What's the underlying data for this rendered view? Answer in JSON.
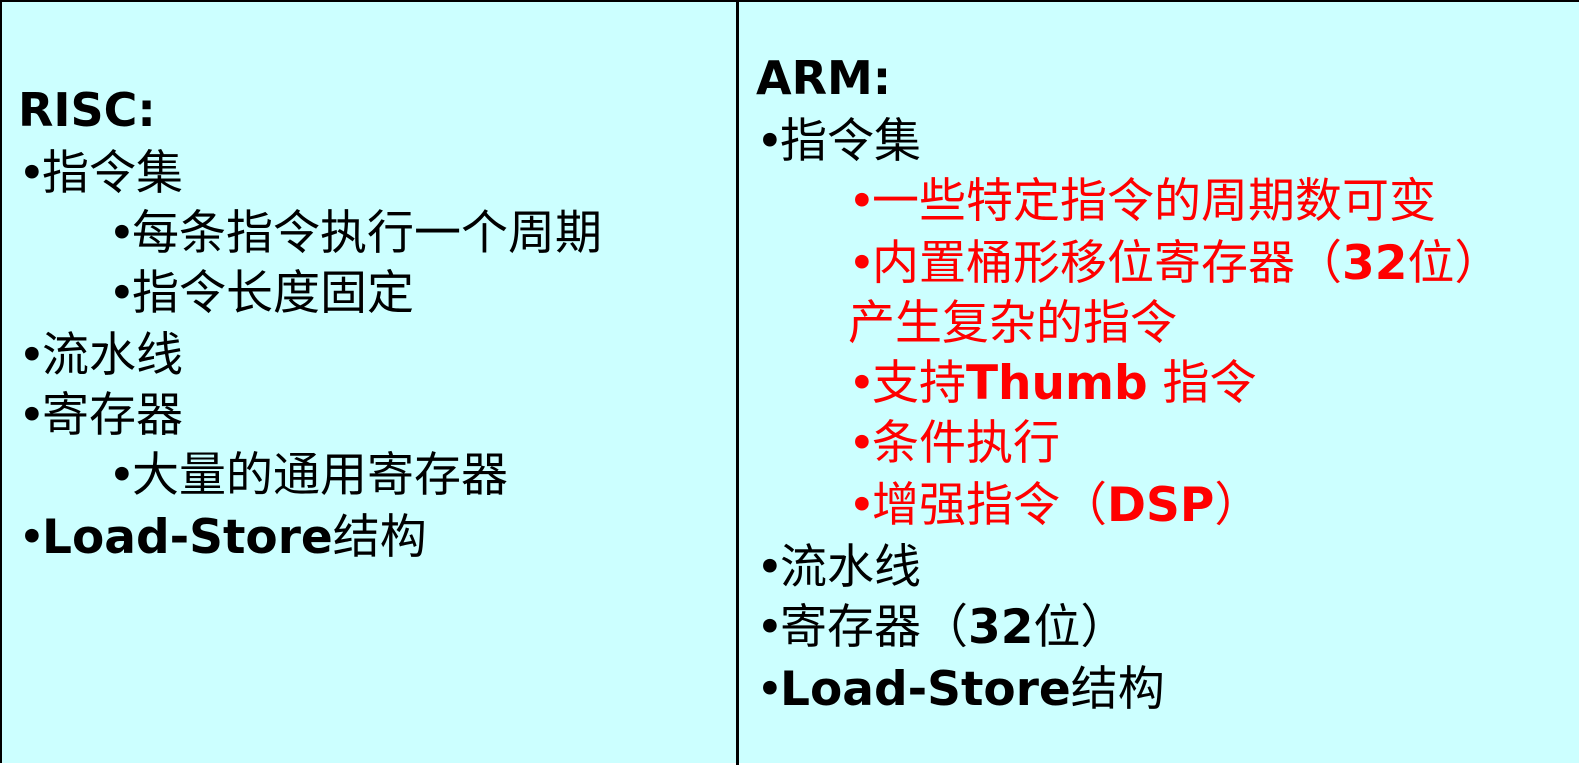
{
  "risc": {
    "heading": "RISC:",
    "items": [
      {
        "text": "指令集"
      },
      {
        "text": "每条指令执行一个周期"
      },
      {
        "text": "指令长度固定"
      },
      {
        "text": "流水线"
      },
      {
        "text": "寄存器"
      },
      {
        "text": "大量的通用寄存器"
      },
      {
        "bold": "Load-Store",
        "text": "结构"
      }
    ]
  },
  "arm": {
    "heading": "ARM:",
    "items": [
      {
        "text": "指令集"
      },
      {
        "text": "一些特定指令的周期数可变"
      },
      {
        "text": "内置桶形移位寄存器（",
        "bold": "32",
        "tail": "位）"
      },
      {
        "text": "产生复杂的指令"
      },
      {
        "text": "支持",
        "bold": "Thumb",
        "tail": " 指令"
      },
      {
        "text": "条件执行"
      },
      {
        "text": "增强指令（",
        "bold": "DSP",
        "tail": "）"
      },
      {
        "text": "流水线"
      },
      {
        "text": "寄存器（",
        "bold": "32",
        "tail": "位）"
      },
      {
        "bold": "Load-Store",
        "text": "结构"
      }
    ]
  },
  "bullet_char": "•",
  "colors": {
    "background": "#ccffff",
    "highlight": "#ff0000",
    "text": "#000000"
  }
}
